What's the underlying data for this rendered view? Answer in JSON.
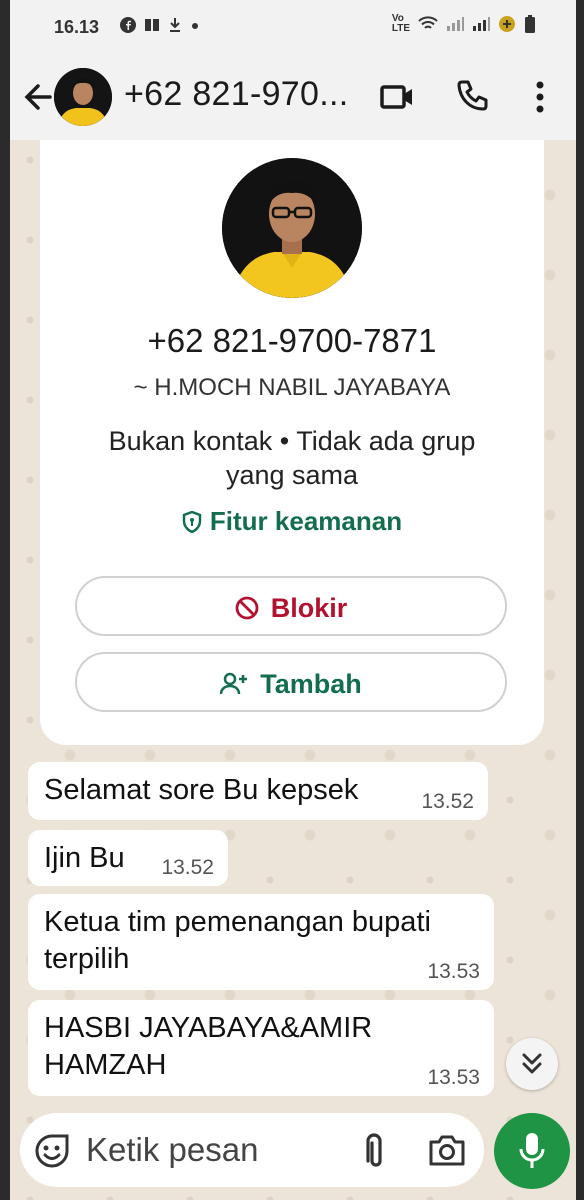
{
  "status": {
    "time": "16.13"
  },
  "header": {
    "title": "+62 821-970..."
  },
  "profile": {
    "phone": "+62 821-9700-7871",
    "name": "~ H.MOCH NABIL JAYABAYA",
    "info": "Bukan kontak • Tidak ada grup yang sama",
    "security_label": "Fitur keamanan",
    "block_label": "Blokir",
    "add_label": "Tambah"
  },
  "messages": [
    {
      "text": "Selamat sore Bu kepsek",
      "time": "13.52"
    },
    {
      "text": "Ijin Bu",
      "time": "13.52"
    },
    {
      "text": "Ketua tim pemenangan bupati terpilih",
      "time": "13.53"
    },
    {
      "text": "HASBI JAYABAYA&AMIR HAMZAH",
      "time": "13.53"
    }
  ],
  "composer": {
    "placeholder": "Ketik pesan"
  },
  "colors": {
    "accent_green": "#136e4e",
    "block_red": "#b3122e",
    "mic_green": "#1f9445"
  }
}
